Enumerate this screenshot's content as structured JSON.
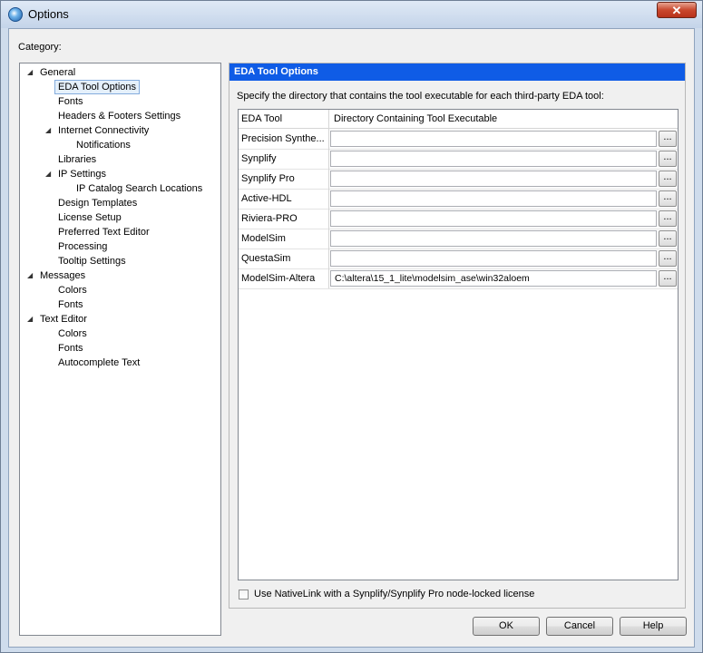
{
  "window": {
    "title": "Options"
  },
  "category_label": "Category:",
  "tree": [
    {
      "label": "General",
      "level": 0,
      "expanded": true
    },
    {
      "label": "EDA Tool Options",
      "level": 1,
      "selected": true
    },
    {
      "label": "Fonts",
      "level": 1
    },
    {
      "label": "Headers & Footers Settings",
      "level": 1
    },
    {
      "label": "Internet Connectivity",
      "level": 1,
      "expanded": true
    },
    {
      "label": "Notifications",
      "level": 2
    },
    {
      "label": "Libraries",
      "level": 1
    },
    {
      "label": "IP Settings",
      "level": 1,
      "expanded": true
    },
    {
      "label": "IP Catalog Search Locations",
      "level": 2
    },
    {
      "label": "Design Templates",
      "level": 1
    },
    {
      "label": "License Setup",
      "level": 1
    },
    {
      "label": "Preferred Text Editor",
      "level": 1
    },
    {
      "label": "Processing",
      "level": 1
    },
    {
      "label": "Tooltip Settings",
      "level": 1
    },
    {
      "label": "Messages",
      "level": 0,
      "expanded": true
    },
    {
      "label": "Colors",
      "level": 1
    },
    {
      "label": "Fonts",
      "level": 1
    },
    {
      "label": "Text Editor",
      "level": 0,
      "expanded": true
    },
    {
      "label": "Colors",
      "level": 1
    },
    {
      "label": "Fonts",
      "level": 1
    },
    {
      "label": "Autocomplete Text",
      "level": 1
    }
  ],
  "panel": {
    "header": "EDA Tool Options",
    "description": "Specify the directory that contains the tool executable for each third-party EDA tool:",
    "columns": [
      "EDA Tool",
      "Directory Containing Tool Executable"
    ],
    "rows": [
      {
        "tool": "Precision Synthe...",
        "path": ""
      },
      {
        "tool": "Synplify",
        "path": ""
      },
      {
        "tool": "Synplify Pro",
        "path": ""
      },
      {
        "tool": "Active-HDL",
        "path": ""
      },
      {
        "tool": "Riviera-PRO",
        "path": ""
      },
      {
        "tool": "ModelSim",
        "path": ""
      },
      {
        "tool": "QuestaSim",
        "path": ""
      },
      {
        "tool": "ModelSim-Altera",
        "path": "C:\\altera\\15_1_lite\\modelsim_ase\\win32aloem"
      }
    ],
    "browse_label": "...",
    "nativelink_checkbox": {
      "label": "Use NativeLink with a Synplify/Synplify Pro node-locked license",
      "checked": false
    }
  },
  "buttons": {
    "ok": "OK",
    "cancel": "Cancel",
    "help": "Help"
  },
  "colors": {
    "panel_header_bg": "#0f5ce6",
    "close_button": "#c9482e",
    "selection_bg": "#e5f0fb"
  }
}
